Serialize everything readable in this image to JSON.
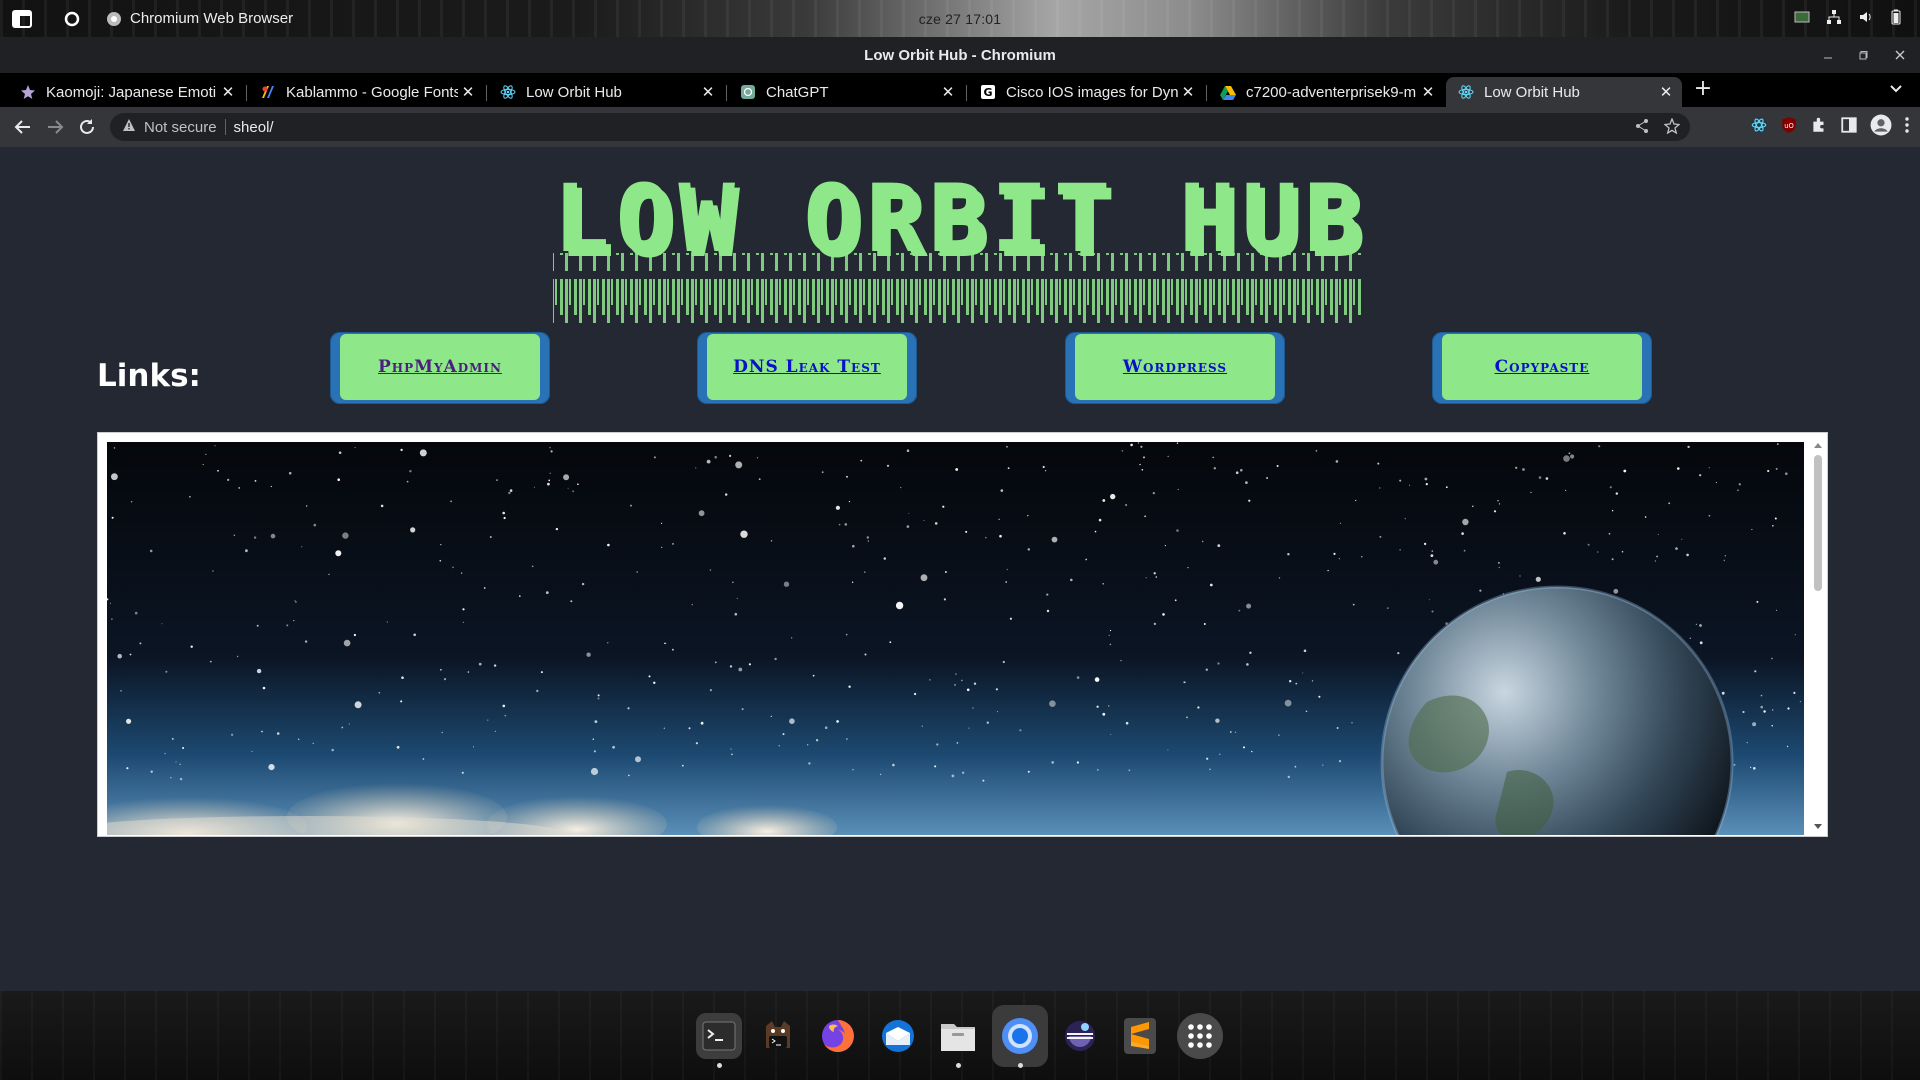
{
  "topbar": {
    "active_app": "Chromium Web Browser",
    "clock": "cze 27  17:01"
  },
  "window": {
    "title": "Low Orbit Hub - Chromium"
  },
  "tabs": [
    {
      "label": "Kaomoji: Japanese Emoti",
      "favicon": "star-icon"
    },
    {
      "label": "Kablammo - Google Fonts",
      "favicon": "google-fonts-icon"
    },
    {
      "label": "Low Orbit Hub",
      "favicon": "atom-icon"
    },
    {
      "label": "ChatGPT",
      "favicon": "chatgpt-icon"
    },
    {
      "label": "Cisco IOS images for Dyna",
      "favicon": "g-letter-icon"
    },
    {
      "label": "c7200-adventerprisek9-m",
      "favicon": "google-drive-icon"
    },
    {
      "label": "Low Orbit Hub",
      "favicon": "atom-icon",
      "active": true
    }
  ],
  "toolbar": {
    "security_label": "Not secure",
    "url": "sheol/"
  },
  "page": {
    "logo_text": "LOW ORBIT HUB",
    "logo_color": "#8ee88a",
    "links_label": "Links:",
    "links": [
      {
        "label": "PhpMyAdmin",
        "color": "#4b1f7d"
      },
      {
        "label": "DNS Leak Test",
        "color": "#0a10c8"
      },
      {
        "label": "Wordpress",
        "color": "#0a10c8"
      },
      {
        "label": "Copypaste",
        "color": "#0a10c8"
      }
    ]
  },
  "dock": {
    "items": [
      "terminal-icon",
      "terminal-cat-icon",
      "firefox-icon",
      "thunderbird-icon",
      "files-icon",
      "chromium-icon",
      "eclipse-icon",
      "sublime-text-icon",
      "app-grid-icon"
    ]
  }
}
